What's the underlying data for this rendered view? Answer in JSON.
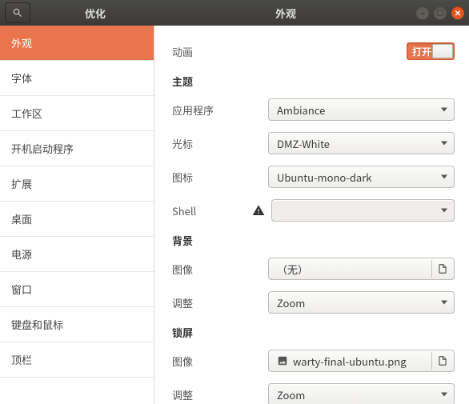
{
  "titlebar": {
    "title_sidebar": "优化",
    "title_main": "外观"
  },
  "sidebar": {
    "items": [
      {
        "label": "外观"
      },
      {
        "label": "字体"
      },
      {
        "label": "工作区"
      },
      {
        "label": "开机启动程序"
      },
      {
        "label": "扩展"
      },
      {
        "label": "桌面"
      },
      {
        "label": "电源"
      },
      {
        "label": "窗口"
      },
      {
        "label": "键盘和鼠标"
      },
      {
        "label": "顶栏"
      }
    ]
  },
  "content": {
    "animations": {
      "label": "动画",
      "toggle_text": "打开"
    },
    "theme": {
      "heading": "主题",
      "app": {
        "label": "应用程序",
        "value": "Ambiance"
      },
      "cursor": {
        "label": "光标",
        "value": "DMZ-White"
      },
      "icons": {
        "label": "图标",
        "value": "Ubuntu-mono-dark"
      },
      "shell": {
        "label": "Shell",
        "value": ""
      }
    },
    "background": {
      "heading": "背景",
      "image": {
        "label": "图像",
        "value": "（无）"
      },
      "adjust": {
        "label": "调整",
        "value": "Zoom"
      }
    },
    "lockscreen": {
      "heading": "锁屏",
      "image": {
        "label": "图像",
        "value": "warty-final-ubuntu.png"
      },
      "adjust": {
        "label": "调整",
        "value": "Zoom"
      }
    }
  }
}
